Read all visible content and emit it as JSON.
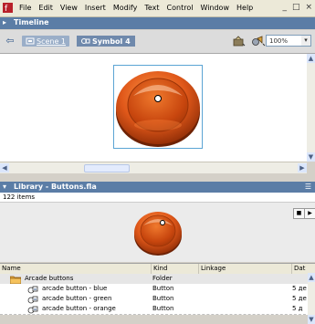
{
  "menubar": {
    "items": [
      "File",
      "Edit",
      "View",
      "Insert",
      "Modify",
      "Text",
      "Control",
      "Window",
      "Help"
    ],
    "window_controls": [
      "_",
      "□",
      "×"
    ]
  },
  "timeline": {
    "label": "Timeline"
  },
  "editbar": {
    "scene_label": "Scene 1",
    "symbol_label": "Symbol 4",
    "zoom_value": "100%"
  },
  "library": {
    "title": "Library - Buttons.fla",
    "item_count": "122 items",
    "columns": [
      "Name",
      "Kind",
      "Linkage",
      "Dat"
    ],
    "rows": [
      {
        "name": "Arcade buttons",
        "kind": "Folder",
        "date": "",
        "type": "folder"
      },
      {
        "name": "arcade button - blue",
        "kind": "Button",
        "date": "5 де",
        "type": "button"
      },
      {
        "name": "arcade button - green",
        "kind": "Button",
        "date": "5 де",
        "type": "button"
      },
      {
        "name": "arcade button - orange",
        "kind": "Button",
        "date": "5 д",
        "type": "button"
      }
    ]
  },
  "colors": {
    "panel_title": "#5b7da6",
    "button_orange": "#e0581a",
    "selection_frame": "#5ba4d4"
  }
}
